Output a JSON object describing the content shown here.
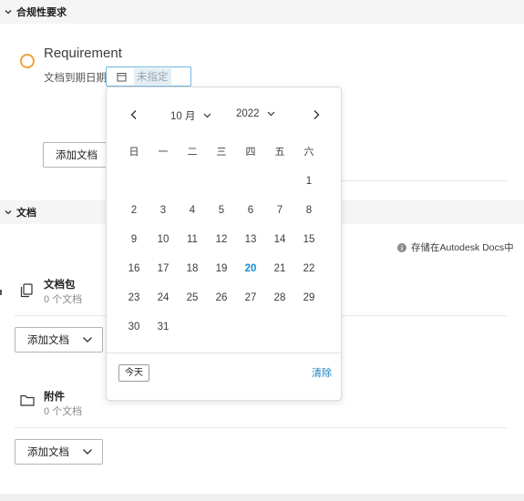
{
  "compliance": {
    "title": "合规性要求"
  },
  "requirement": {
    "title": "Requirement",
    "due_label": "文档到期日期",
    "due_placeholder": "未指定",
    "add_button": "添加文档"
  },
  "documents": {
    "title": "文档",
    "storage_note": "存储在Autodesk Docs中",
    "package": {
      "title": "文档包",
      "count": "0 个文档",
      "add_button": "添加文档"
    },
    "attachments": {
      "title": "附件",
      "count": "0 个文档",
      "add_button": "添加文档"
    }
  },
  "calendar": {
    "month": "10 月",
    "year": "2022",
    "weekdays": [
      "日",
      "一",
      "二",
      "三",
      "四",
      "五",
      "六"
    ],
    "days": [
      [
        "",
        "",
        "",
        "",
        "",
        "",
        "1"
      ],
      [
        "2",
        "3",
        "4",
        "5",
        "6",
        "7",
        "8"
      ],
      [
        "9",
        "10",
        "11",
        "12",
        "13",
        "14",
        "15"
      ],
      [
        "16",
        "17",
        "18",
        "19",
        "20",
        "21",
        "22"
      ],
      [
        "23",
        "24",
        "25",
        "26",
        "27",
        "28",
        "29"
      ],
      [
        "30",
        "31",
        "",
        "",
        "",
        "",
        ""
      ]
    ],
    "today_day": "20",
    "today_button": "今天",
    "clear_button": "清除"
  },
  "colors": {
    "accent": "#1a8bd1",
    "link": "#1a7fc1",
    "status_ring": "#f0a23a",
    "input_border": "#6fb8e0"
  },
  "icons": [
    "chevron-down-icon",
    "calendar-icon",
    "chevron-left-icon",
    "chevron-right-icon",
    "info-icon",
    "package-icon",
    "folder-icon"
  ]
}
